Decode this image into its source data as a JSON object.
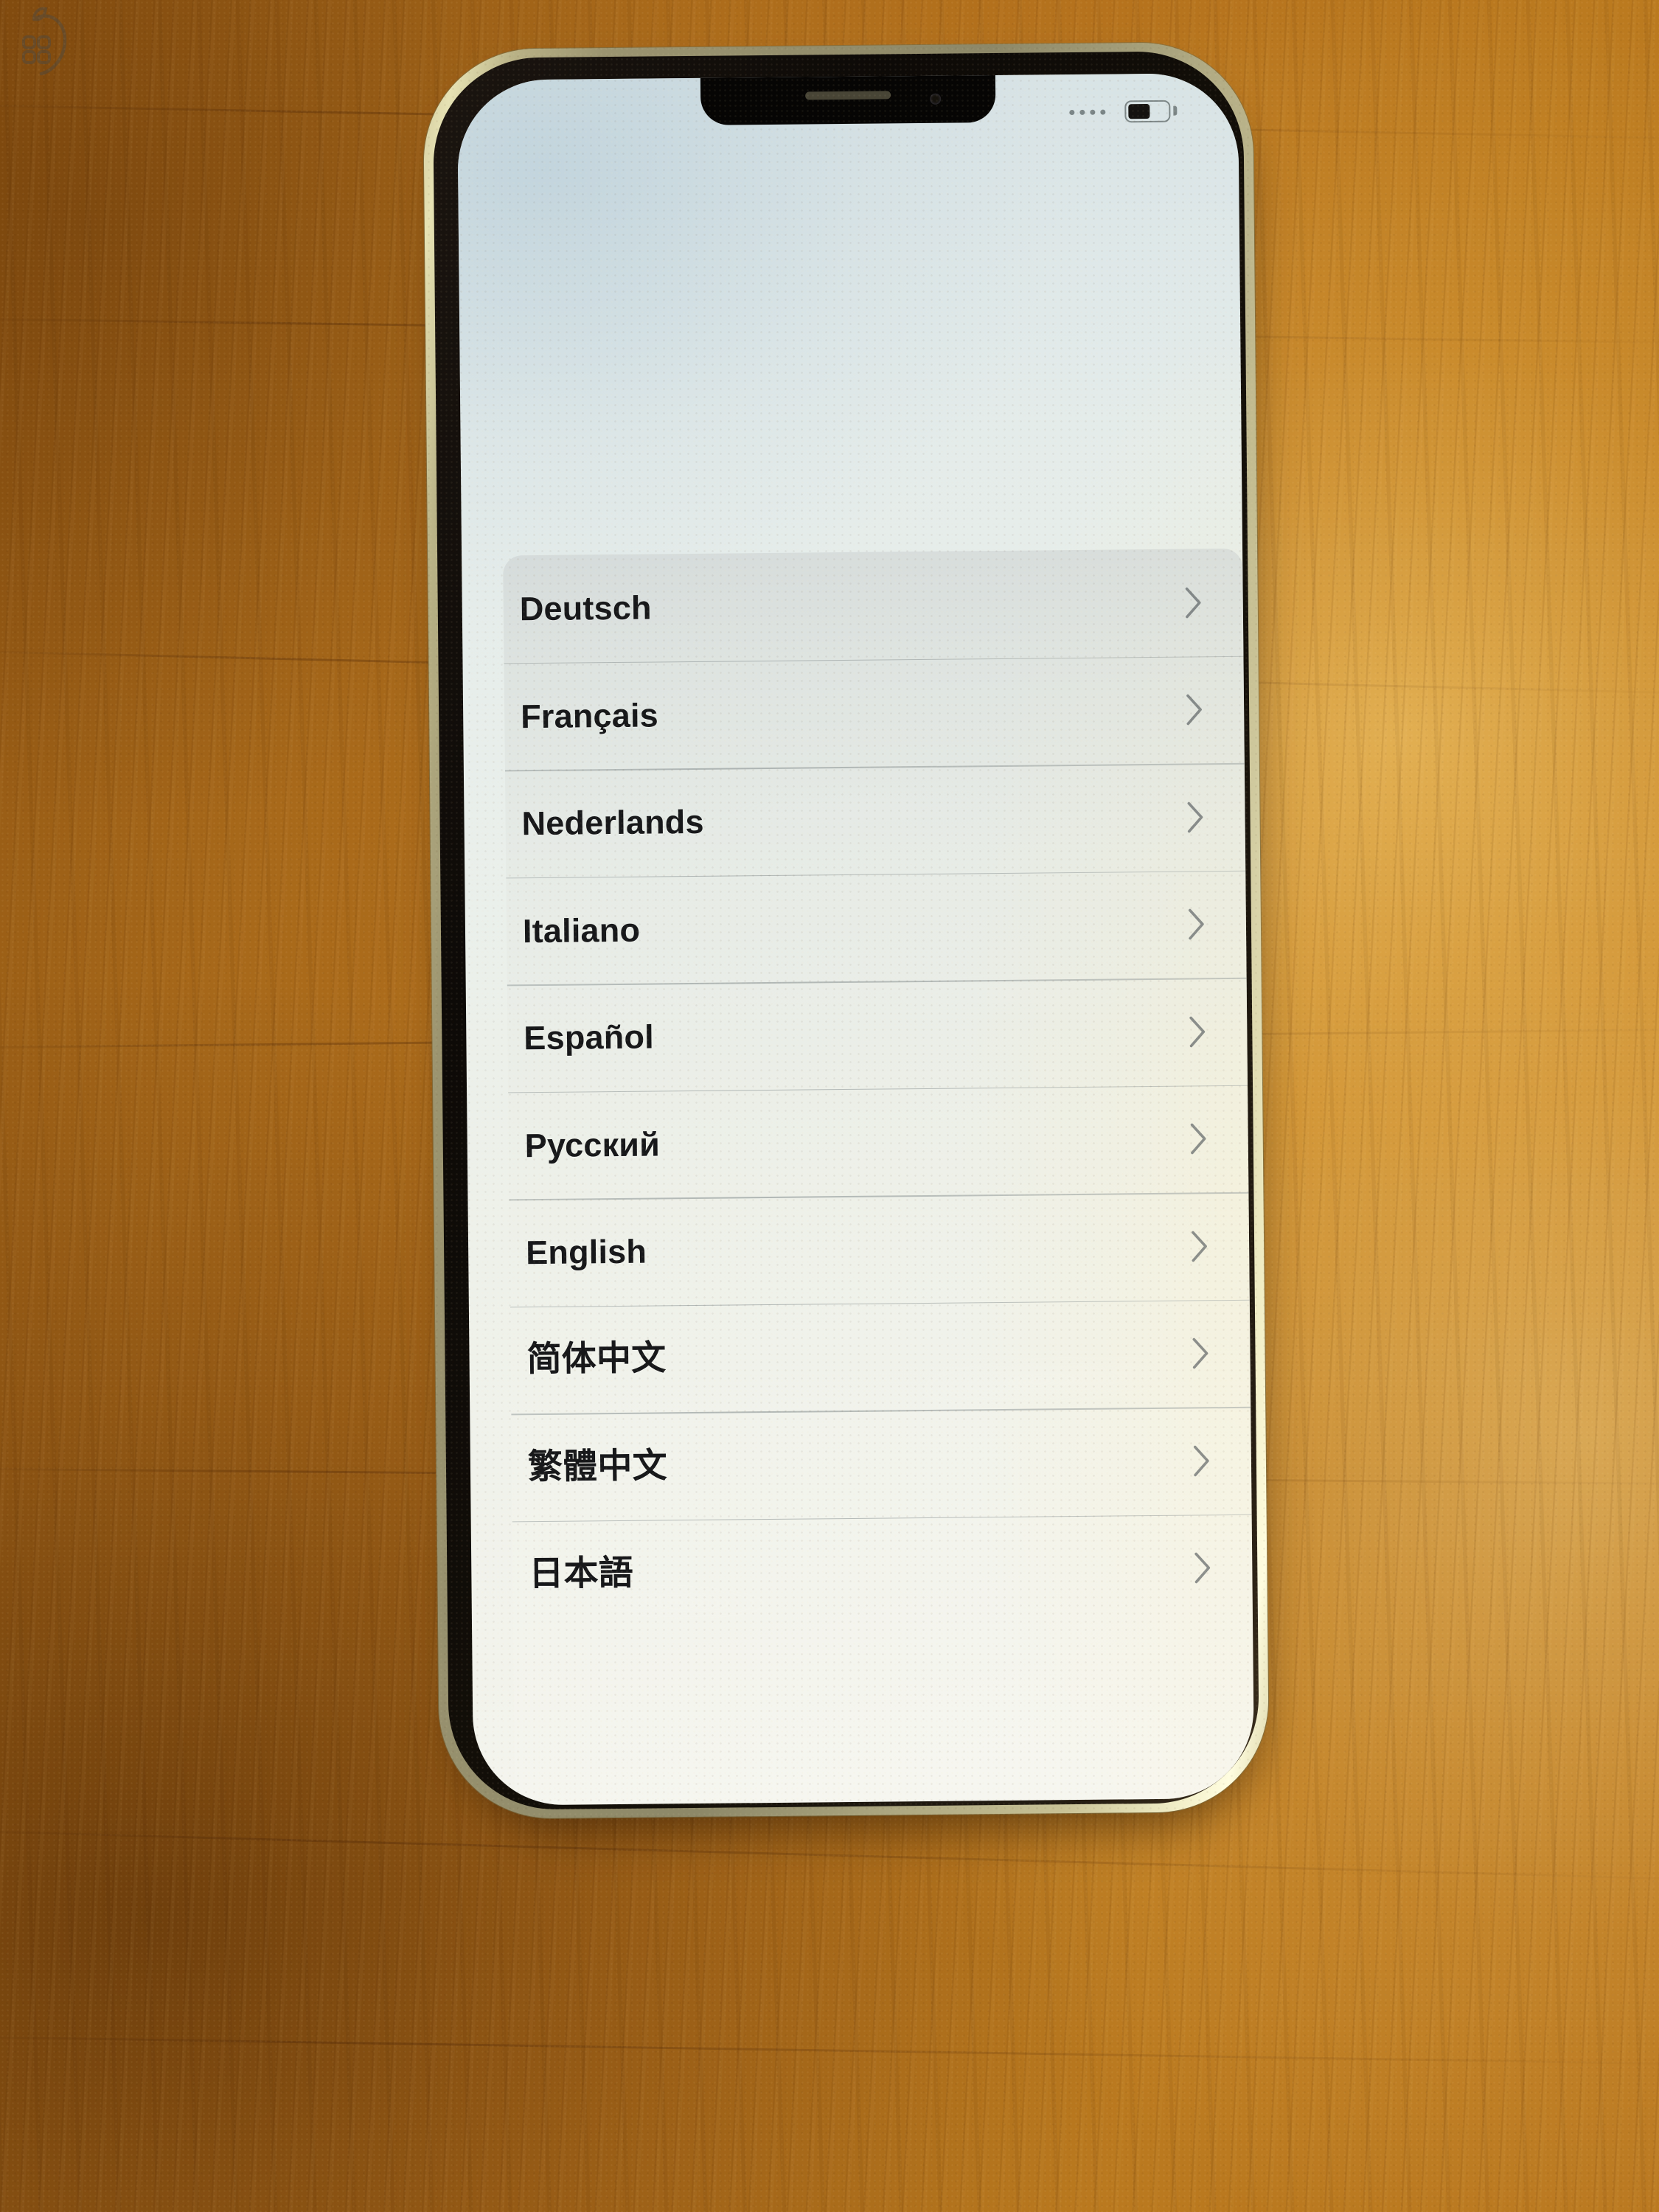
{
  "scene": {
    "description": "photo-of-phone-on-wooden-desk",
    "desk_color": "#a8691a",
    "glare_color": "#ffd778",
    "watermark_name": "apple-grid-logo-watermark"
  },
  "device": {
    "name": "iphone",
    "frame_color": "#cfc79a",
    "bezel_color": "#0d0a07",
    "screen_bg": "#eef1ea",
    "notch_name": "notch",
    "speaker_name": "earpiece-speaker",
    "camera_name": "front-camera"
  },
  "status_bar": {
    "signal_dots": 4,
    "signal_dot_color": "#7b8688",
    "battery_level_percent": 55,
    "battery_outline_color": "#7d8788",
    "battery_fill_color": "#141210"
  },
  "screen": {
    "title": "",
    "list_name": "language-selection-list",
    "chevron_icon": "chevron-right-icon",
    "languages": [
      {
        "label": "Deutsch",
        "script": "latin"
      },
      {
        "label": "Français",
        "script": "latin"
      },
      {
        "label": "Nederlands",
        "script": "latin"
      },
      {
        "label": "Italiano",
        "script": "latin"
      },
      {
        "label": "Español",
        "script": "latin"
      },
      {
        "label": "Русский",
        "script": "cyrillic"
      },
      {
        "label": "English",
        "script": "latin"
      },
      {
        "label": "简体中文",
        "script": "cjk"
      },
      {
        "label": "繁體中文",
        "script": "cjk"
      },
      {
        "label": "日本語",
        "script": "cjk"
      }
    ]
  }
}
